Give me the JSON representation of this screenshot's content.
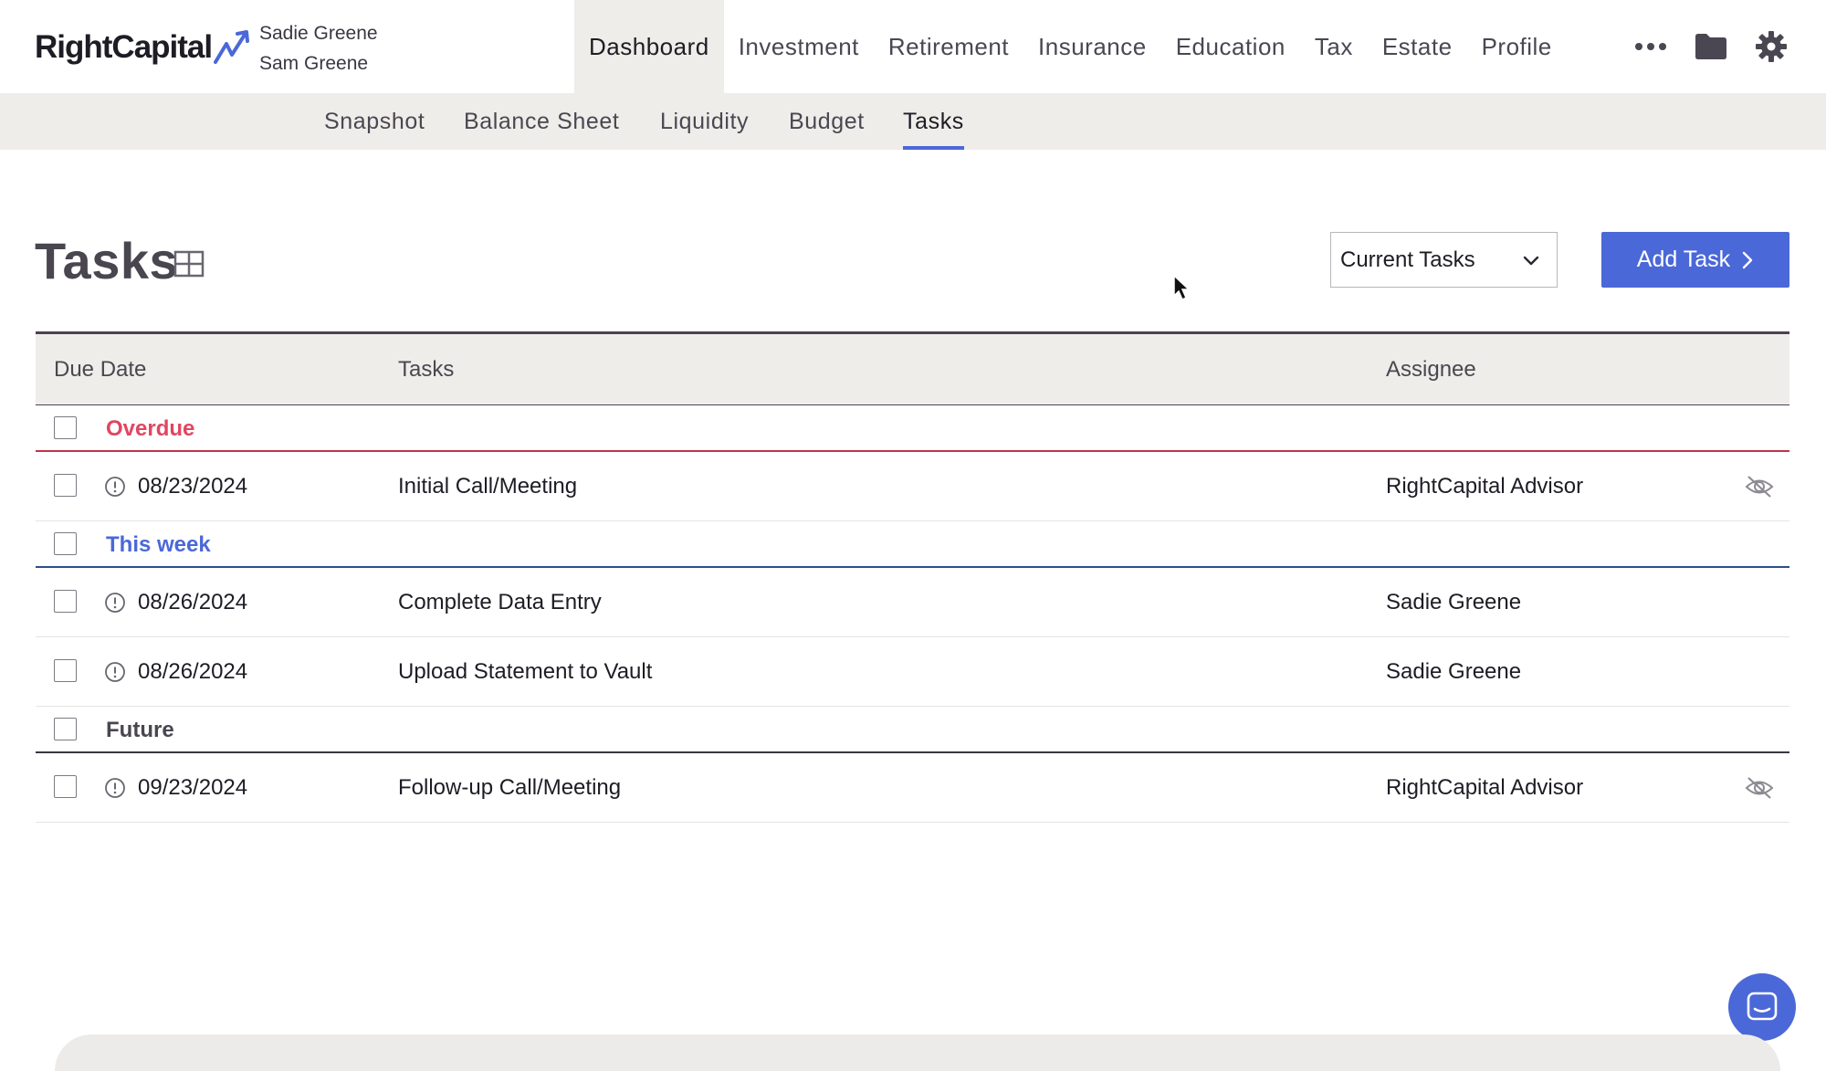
{
  "brand": {
    "name": "RightCapital",
    "icon": "trend-arrow-icon",
    "accent": "#4b68d8"
  },
  "clients": [
    "Sadie Greene",
    "Sam Greene"
  ],
  "main_nav": {
    "items": [
      {
        "label": "Dashboard",
        "active": true
      },
      {
        "label": "Investment",
        "active": false
      },
      {
        "label": "Retirement",
        "active": false
      },
      {
        "label": "Insurance",
        "active": false
      },
      {
        "label": "Education",
        "active": false
      },
      {
        "label": "Tax",
        "active": false
      },
      {
        "label": "Estate",
        "active": false
      },
      {
        "label": "Profile",
        "active": false
      }
    ],
    "icons": [
      "more-icon",
      "folder-icon",
      "gear-icon"
    ]
  },
  "sub_nav": {
    "items": [
      {
        "label": "Snapshot",
        "active": false
      },
      {
        "label": "Balance Sheet",
        "active": false
      },
      {
        "label": "Liquidity",
        "active": false
      },
      {
        "label": "Budget",
        "active": false
      },
      {
        "label": "Tasks",
        "active": true
      }
    ]
  },
  "page": {
    "title": "Tasks",
    "filter": {
      "selected": "Current Tasks"
    },
    "add_button": "Add Task"
  },
  "table": {
    "headers": {
      "due_date": "Due Date",
      "tasks": "Tasks",
      "assignee": "Assignee"
    },
    "groups": [
      {
        "label": "Overdue",
        "color": "#e04660",
        "tasks": [
          {
            "date": "08/23/2024",
            "name": "Initial Call/Meeting",
            "assignee": "RightCapital Advisor",
            "hidden_from_client": true
          }
        ]
      },
      {
        "label": "This week",
        "color": "#4b68d8",
        "tasks": [
          {
            "date": "08/26/2024",
            "name": "Complete Data Entry",
            "assignee": "Sadie Greene",
            "hidden_from_client": false
          },
          {
            "date": "08/26/2024",
            "name": "Upload Statement to Vault",
            "assignee": "Sadie Greene",
            "hidden_from_client": false
          }
        ]
      },
      {
        "label": "Future",
        "color": "#4a4650",
        "tasks": [
          {
            "date": "09/23/2024",
            "name": "Follow-up Call/Meeting",
            "assignee": "RightCapital Advisor",
            "hidden_from_client": true
          }
        ]
      }
    ]
  }
}
